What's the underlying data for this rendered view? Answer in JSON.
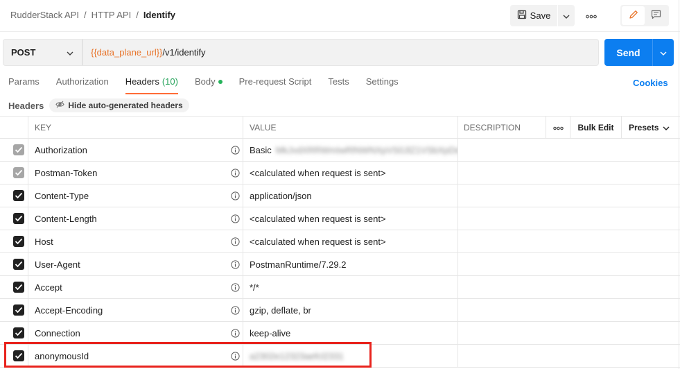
{
  "breadcrumb": {
    "items": [
      "RudderStack API",
      "HTTP API"
    ],
    "separator": "/",
    "current": "Identify"
  },
  "toolbar": {
    "save_label": "Save",
    "save_icon": "save-icon",
    "more_icon": "more-horizontal-icon",
    "edit_icon": "pencil-icon",
    "comment_icon": "comment-icon"
  },
  "request": {
    "method": "POST",
    "url_variable": "{{data_plane_url}}",
    "url_path": "/v1/identify",
    "send_label": "Send"
  },
  "tabs": [
    {
      "label": "Params"
    },
    {
      "label": "Authorization"
    },
    {
      "label": "Headers",
      "count": "(10)",
      "active": true
    },
    {
      "label": "Body",
      "dot": true
    },
    {
      "label": "Pre-request Script"
    },
    {
      "label": "Tests"
    },
    {
      "label": "Settings"
    }
  ],
  "cookies_label": "Cookies",
  "headers_section": {
    "label": "Headers",
    "hide_button": "Hide auto-generated headers"
  },
  "table": {
    "columns": {
      "key": "KEY",
      "value": "VALUE",
      "description": "DESCRIPTION",
      "bulk_edit": "Bulk Edit",
      "presets": "Presets"
    },
    "rows": [
      {
        "key": "Authorization",
        "value": "Basic",
        "secret": "MkJvdXRRWmIwRlNWNXpVS0JlZ1VSbXpDeE1VZGU6",
        "checked": true,
        "disabled": true
      },
      {
        "key": "Postman-Token",
        "value": "<calculated when request is sent>",
        "checked": true,
        "disabled": true
      },
      {
        "key": "Content-Type",
        "value": "application/json",
        "checked": true,
        "disabled": false
      },
      {
        "key": "Content-Length",
        "value": "<calculated when request is sent>",
        "checked": true,
        "disabled": false
      },
      {
        "key": "Host",
        "value": "<calculated when request is sent>",
        "checked": true,
        "disabled": false
      },
      {
        "key": "User-Agent",
        "value": "PostmanRuntime/7.29.2",
        "checked": true,
        "disabled": false
      },
      {
        "key": "Accept",
        "value": "*/*",
        "checked": true,
        "disabled": false
      },
      {
        "key": "Accept-Encoding",
        "value": "gzip, deflate, br",
        "checked": true,
        "disabled": false
      },
      {
        "key": "Connection",
        "value": "keep-alive",
        "checked": true,
        "disabled": false
      },
      {
        "key": "anonymousId",
        "value": "",
        "secret": "a2302e12323aefcl2331",
        "checked": true,
        "disabled": false
      }
    ]
  },
  "colors": {
    "accent": "#0c7ef0",
    "variable": "#e8742a",
    "tab_underline": "#ff6c37",
    "highlight": "#e8231d"
  }
}
